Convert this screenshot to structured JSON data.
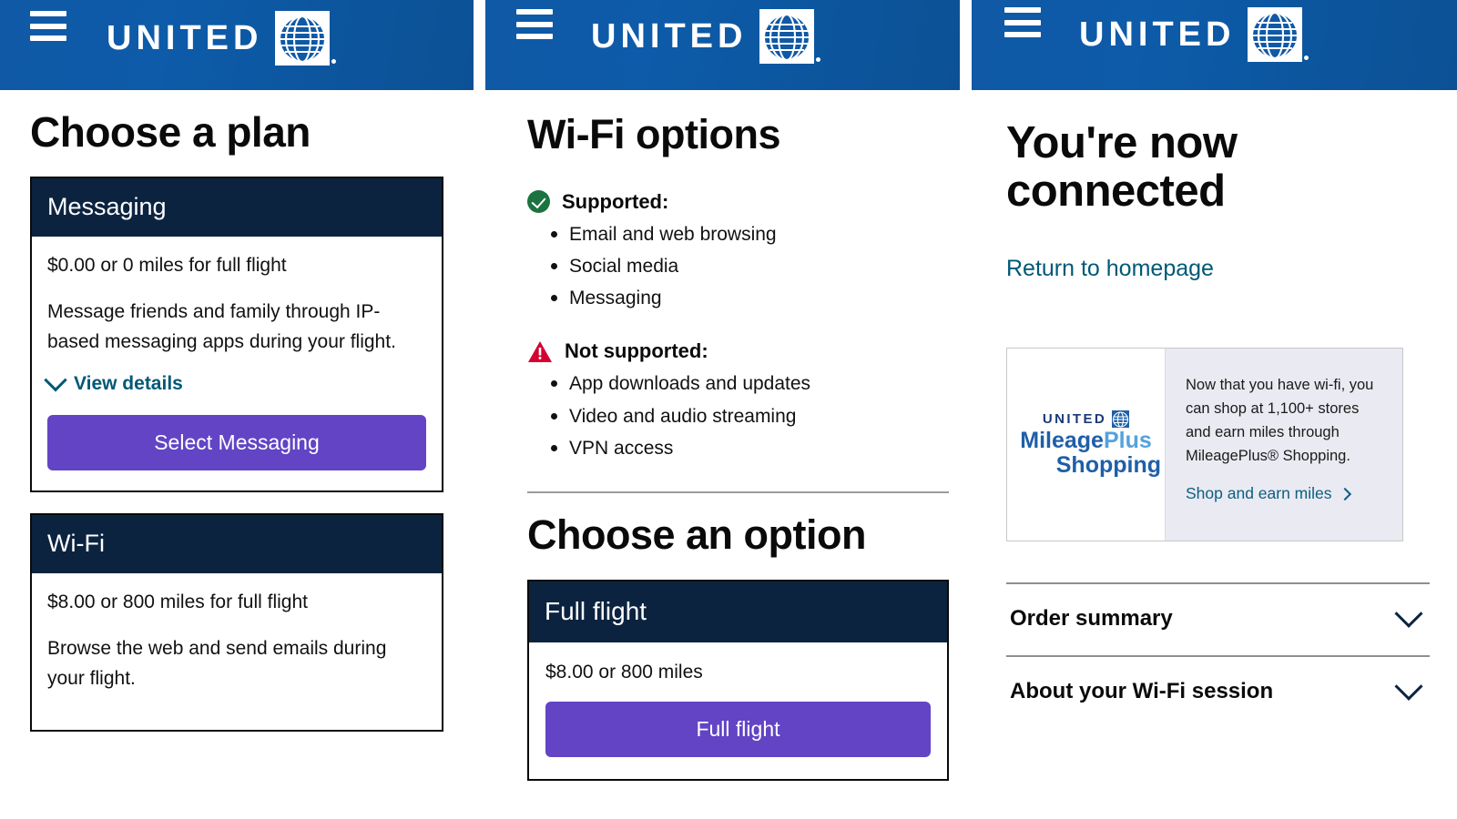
{
  "brand": {
    "name": "UNITED",
    "header_color": "#0d5ba9",
    "navy": "#0c2340",
    "purple": "#6244c5",
    "link_color": "#005876",
    "green": "#1b7340",
    "red": "#d50032"
  },
  "panel1": {
    "title": "Choose a plan",
    "cards": [
      {
        "name": "Messaging",
        "price": "$0.00 or 0 miles for full flight",
        "description": "Message friends and family through IP-based messaging apps during your flight.",
        "details_link": "View details",
        "button": "Select Messaging"
      },
      {
        "name": "Wi-Fi",
        "price": "$8.00 or 800 miles for full flight",
        "description": "Browse the web and send emails during your flight."
      }
    ]
  },
  "panel2": {
    "title": "Wi-Fi options",
    "supported": {
      "label": "Supported:",
      "items": [
        "Email and web browsing",
        "Social media",
        "Messaging"
      ]
    },
    "not_supported": {
      "label": "Not supported:",
      "items": [
        "App downloads and updates",
        "Video and audio streaming",
        "VPN access"
      ]
    },
    "choose_title": "Choose an option",
    "option": {
      "name": "Full flight",
      "price": "$8.00 or 800 miles",
      "button": "Full flight"
    }
  },
  "panel3": {
    "title": "You're now connected",
    "return_link": "Return to homepage",
    "promo": {
      "logo_united": "UNITED",
      "logo_line1_a": "Mileage",
      "logo_line1_b": "Plus",
      "logo_line2": "Shopping",
      "copy": "Now that you have wi-fi, you can shop at 1,100+ stores and earn miles through MileagePlus® Shopping.",
      "cta": "Shop and earn miles"
    },
    "accordions": [
      {
        "label": "Order summary"
      },
      {
        "label": "About your Wi-Fi session"
      }
    ]
  }
}
